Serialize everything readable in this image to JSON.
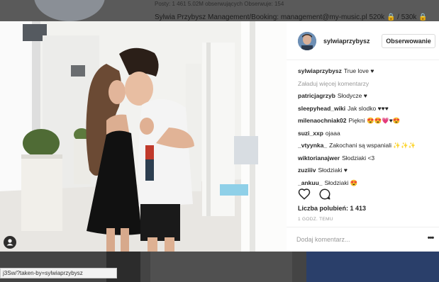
{
  "background": {
    "stats_line": "Posty: 1 461     5.02M obserwujących     Obserwuje: 154",
    "profile_line": "Sylwia Przybysz Management/Booking: management@my-music.pl 520k 🔒 / 530k 🔒"
  },
  "status_url": "j3Sw/?taken-by=sylwiaprzybysz",
  "post": {
    "username": "sylwiaprzybysz",
    "follow_label": "Obserwowanie",
    "caption": {
      "user": "sylwiaprzybysz",
      "text": "True love ♥"
    },
    "load_more": "Załaduj więcej komentarzy",
    "comments": [
      {
        "user": "patricjagrzyb",
        "text": "Słodycze ♥"
      },
      {
        "user": "sleepyhead_wiki",
        "text": "Jak slodko ♥♥♥"
      },
      {
        "user": "milenaochniak02",
        "text": "Piękni 😍😍💗♥😍"
      },
      {
        "user": "suzi_xxp",
        "text": "ojaaa"
      },
      {
        "user": "_vtyynka_",
        "text": "Zakochani są wspaniali ✨✨✨"
      },
      {
        "user": "wiktorianajwer",
        "text": "Słodziaki <3"
      },
      {
        "user": "zuziiiv",
        "text": "Słodziaki ♥"
      },
      {
        "user": "_ankuu_",
        "text": "Słodziaki 😍"
      }
    ],
    "likes": "Liczba polubień: 1 413",
    "time": "1 GODZ. TEMU",
    "comment_placeholder": "Dodaj komentarz...",
    "more_label": "•••"
  },
  "icons": {
    "like": "heart-icon",
    "comment": "comment-bubble-icon",
    "tag": "person-tag-icon"
  },
  "colors": {
    "text": "#262626",
    "muted": "#999999",
    "border": "#dbdbdb"
  }
}
